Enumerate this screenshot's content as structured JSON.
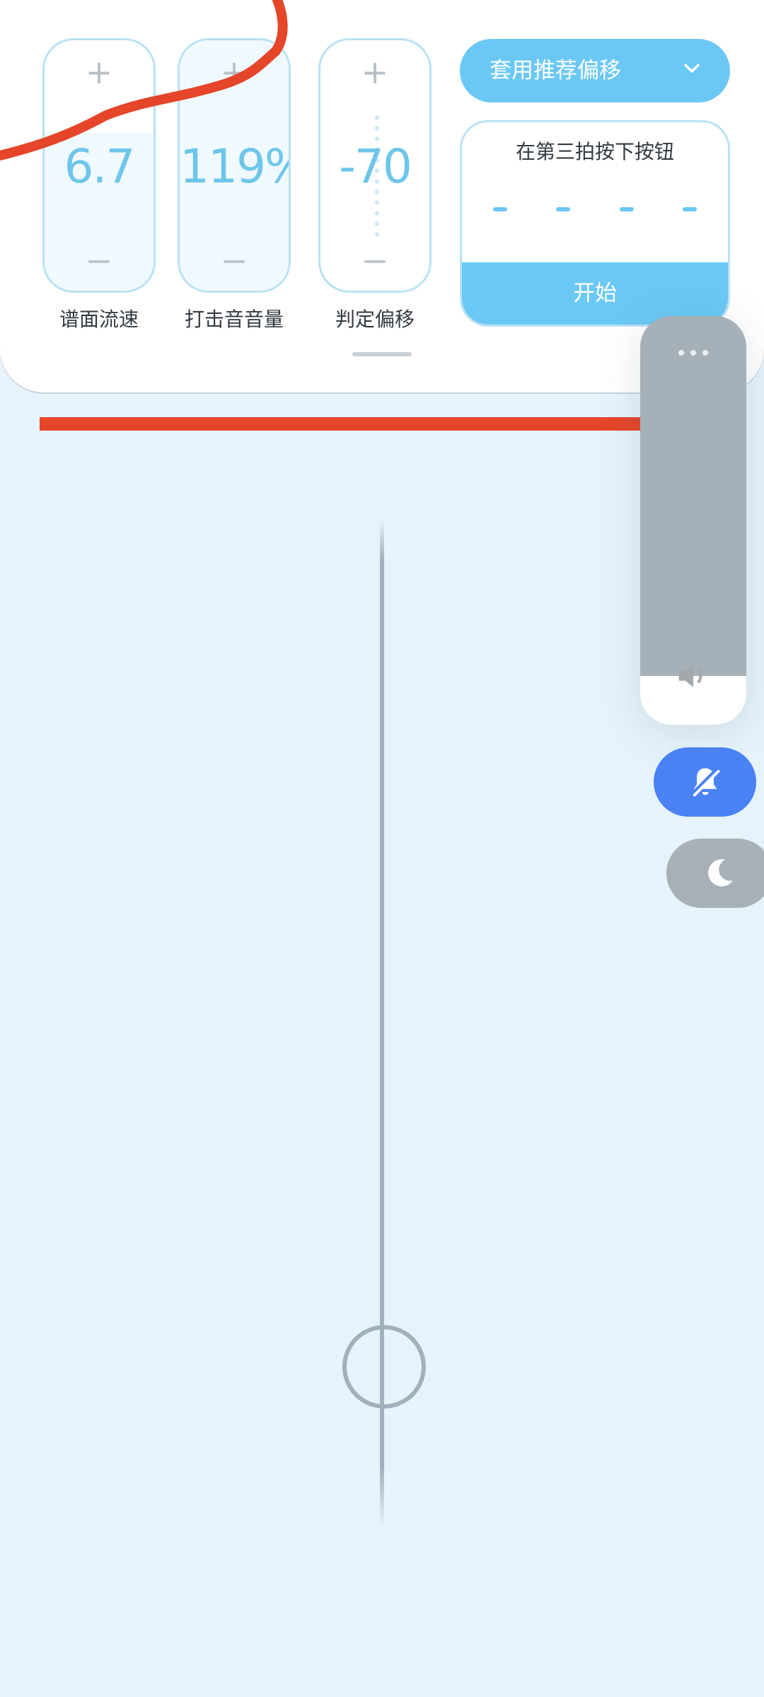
{
  "steppers": [
    {
      "label": "谱面流速",
      "value": "6.7",
      "plus": "+",
      "fill_fraction": 0.63
    },
    {
      "label": "打击音音量",
      "value": "119%",
      "plus": "+",
      "fill_fraction": 1.0
    },
    {
      "label": "判定偏移",
      "value": "-70",
      "plus": "+",
      "fill_fraction": 0.0
    }
  ],
  "offset": {
    "apply_label": "套用推荐偏移",
    "chevron_icon": "chevron-down-icon"
  },
  "calibration": {
    "instruction": "在第三拍按下按钮",
    "beat_count": 4,
    "start_label": "开始"
  },
  "volume": {
    "more_icon": "more-dots-icon",
    "speaker_icon": "speaker-icon",
    "level_fraction": 0.12
  },
  "quick_buttons": {
    "mute_icon": "bell-off-icon",
    "dnd_icon": "moon-icon"
  },
  "colors": {
    "accent": "#6bc8f5",
    "value_text": "#6ec6ea",
    "background": "#e6f3fb",
    "mute_active": "#4a82f4",
    "annotation": "#e54528"
  }
}
